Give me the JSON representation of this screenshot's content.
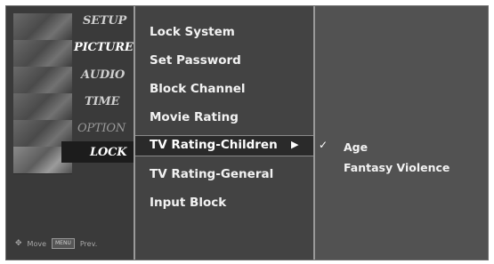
{
  "left_menu": {
    "items": [
      {
        "label": "SETUP",
        "state": "normal"
      },
      {
        "label": "PICTURE",
        "state": "active"
      },
      {
        "label": "AUDIO",
        "state": "normal"
      },
      {
        "label": "TIME",
        "state": "normal"
      },
      {
        "label": "OPTION",
        "state": "dim"
      },
      {
        "label": "LOCK",
        "state": "selected"
      }
    ],
    "footer": {
      "move_label": "Move",
      "prev_key": "MENU",
      "prev_label": "Prev."
    }
  },
  "lock_menu": {
    "items": [
      {
        "label": "Lock System"
      },
      {
        "label": "Set Password"
      },
      {
        "label": "Block Channel"
      },
      {
        "label": "Movie Rating"
      },
      {
        "label": "TV Rating-Children",
        "selected": true
      },
      {
        "label": "TV Rating-General"
      },
      {
        "label": "Input Block"
      }
    ],
    "arrow": "▶"
  },
  "submenu": {
    "items": [
      {
        "label": "Age",
        "checked": true
      },
      {
        "label": "Fantasy Violence",
        "checked": false
      }
    ],
    "check_glyph": "✓"
  },
  "colors": {
    "background": "#2b2b2b",
    "left_panel": "#3a3a3a",
    "center_panel": "#434343",
    "right_panel": "#525252",
    "text": "#f2f2f2",
    "divider": "#9a9a9a"
  }
}
